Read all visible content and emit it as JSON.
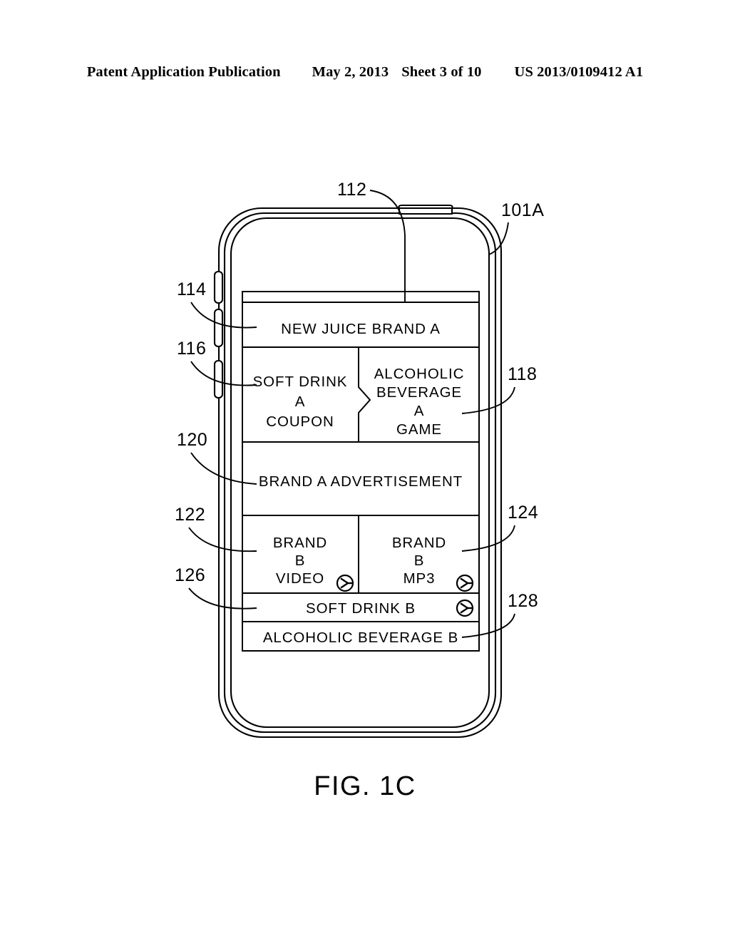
{
  "header": {
    "publication": "Patent Application Publication",
    "date": "May 2, 2013",
    "sheet": "Sheet 3 of 10",
    "docnum": "US 2013/0109412 A1"
  },
  "figure": {
    "caption": "FIG. 1C"
  },
  "device": {
    "reference_label": "101A",
    "screen_reference_label": "112"
  },
  "screen": {
    "rows": [
      {
        "ref": "114",
        "ref_side": "left",
        "cells": [
          {
            "name": "new-juice-brand-a",
            "lines": [
              "NEW JUICE BRAND A"
            ],
            "icon": "none"
          }
        ]
      },
      {
        "ref": "116",
        "ref_side": "left",
        "ref_right": "118",
        "cells": [
          {
            "name": "soft-drink-a-coupon",
            "lines": [
              "SOFT DRINK",
              "A",
              "COUPON"
            ],
            "icon": "none"
          },
          {
            "name": "alcoholic-beverage-a-game",
            "lines": [
              "ALCOHOLIC",
              "BEVERAGE",
              "A",
              "GAME"
            ],
            "icon": "none"
          }
        ]
      },
      {
        "ref": "120",
        "ref_side": "left",
        "cells": [
          {
            "name": "brand-a-advertisement",
            "lines": [
              "BRAND A ADVERTISEMENT"
            ],
            "icon": "none"
          }
        ]
      },
      {
        "ref": "122",
        "ref_side": "left",
        "ref_right": "124",
        "cells": [
          {
            "name": "brand-b-video",
            "lines": [
              "BRAND",
              "B",
              "VIDEO"
            ],
            "icon": "play-arrow-icon"
          },
          {
            "name": "brand-b-mp3",
            "lines": [
              "BRAND",
              "B",
              "MP3"
            ],
            "icon": "play-arrow-icon"
          }
        ]
      },
      {
        "ref": "126",
        "ref_side": "left",
        "cells": [
          {
            "name": "soft-drink-b",
            "lines": [
              "SOFT DRINK B"
            ],
            "icon": "play-arrow-icon"
          }
        ]
      },
      {
        "ref": "128",
        "ref_side": "right",
        "cells": [
          {
            "name": "alcoholic-beverage-b",
            "lines": [
              "ALCOHOLIC BEVERAGE B"
            ],
            "icon": "none"
          }
        ]
      }
    ],
    "labels": {
      "r1c1": "NEW JUICE BRAND A",
      "r2c1_l1": "SOFT DRINK",
      "r2c1_l2": "A",
      "r2c1_l3": "COUPON",
      "r2c2_l1": "ALCOHOLIC",
      "r2c2_l2": "BEVERAGE",
      "r2c2_l3": "A",
      "r2c2_l4": "GAME",
      "r3c1": "BRAND A ADVERTISEMENT",
      "r4c1_l1": "BRAND",
      "r4c1_l2": "B",
      "r4c1_l3": "VIDEO",
      "r4c2_l1": "BRAND",
      "r4c2_l2": "B",
      "r4c2_l3": "MP3",
      "r5c1": "SOFT DRINK B",
      "r6c1": "ALCOHOLIC BEVERAGE B"
    }
  },
  "references": {
    "n101A": "101A",
    "n112": "112",
    "n114": "114",
    "n116": "116",
    "n118": "118",
    "n120": "120",
    "n122": "122",
    "n124": "124",
    "n126": "126",
    "n128": "128"
  },
  "colors": {
    "ink": "#000000",
    "paper": "#ffffff"
  }
}
